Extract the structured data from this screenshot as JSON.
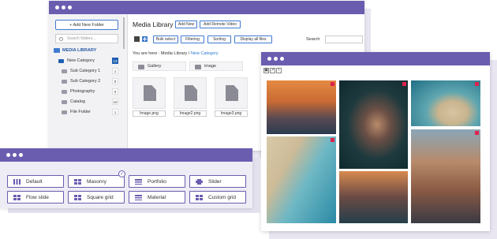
{
  "media_window": {
    "sidebar": {
      "add_folder_label": "+ Add New Folder",
      "search_placeholder": "Search folders...",
      "library_label": "MEDIA LIBRARY",
      "folders": [
        {
          "label": "New Category",
          "count": "13"
        },
        {
          "label": "Sub Category 1",
          "count": "1"
        },
        {
          "label": "Sub Category 2",
          "count": "0"
        },
        {
          "label": "Photography",
          "count": "0"
        },
        {
          "label": "Catalog",
          "count": "10"
        },
        {
          "label": "File Folder",
          "count": "1"
        }
      ]
    },
    "main": {
      "title": "Media Library",
      "add_new_label": "Add New",
      "add_remote_label": "Add Remote Video",
      "toolbar": {
        "bulk_select": "Bulk select",
        "filtering": "Filtering",
        "sorting": "Sorting",
        "display_all": "Display all files",
        "search_label": "Search"
      },
      "breadcrumb": {
        "prefix": "You are here :",
        "root": "Media Library",
        "separator": "/",
        "current": "New Category"
      },
      "folder_tiles": [
        "Gallery",
        "image"
      ],
      "files": [
        "Image.png",
        "Image2.png",
        "Image3.png"
      ]
    }
  },
  "gallery_window": {
    "tool_icons": [
      "image-icon",
      "link-icon",
      "info-icon"
    ],
    "tool_glyphs": [
      "▣",
      "↗",
      "i"
    ]
  },
  "layout_window": {
    "options": [
      {
        "label": "Default",
        "icon": "columns-icon"
      },
      {
        "label": "Masonry",
        "icon": "masonry-icon",
        "selected": true
      },
      {
        "label": "Portfolio",
        "icon": "portfolio-icon"
      },
      {
        "label": "Slider",
        "icon": "slider-icon"
      },
      {
        "label": "Flow slide",
        "icon": "flow-slide-icon"
      },
      {
        "label": "Square grid",
        "icon": "square-grid-icon"
      },
      {
        "label": "Material",
        "icon": "material-icon"
      },
      {
        "label": "Custom grid",
        "icon": "custom-grid-icon"
      }
    ],
    "check_glyph": "✓"
  },
  "colors": {
    "titlebar": "#6a5db0",
    "accent_blue": "#3f7bd0",
    "delete_badge": "#e0224e"
  }
}
